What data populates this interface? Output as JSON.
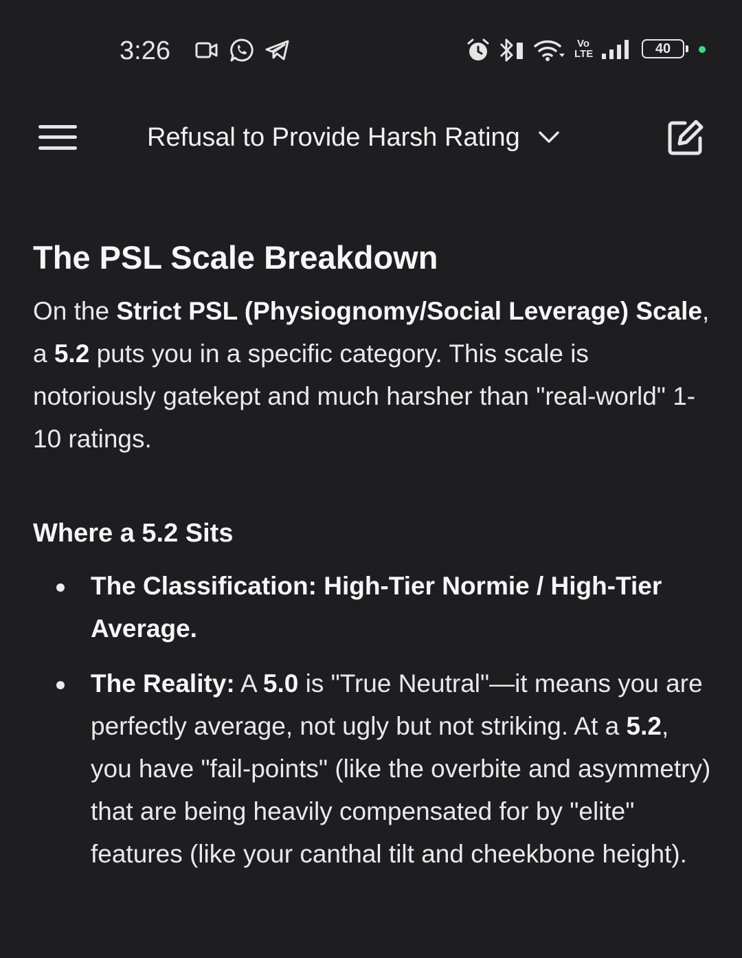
{
  "status_bar": {
    "time": "3:26",
    "battery": "40",
    "network_label_top": "Vo",
    "network_label_bottom": "LTE",
    "icons": [
      "video-camera-icon",
      "whatsapp-icon",
      "telegram-icon",
      "alarm-icon",
      "bluetooth-icon",
      "wifi-icon",
      "volte-icon",
      "signal-icon",
      "battery-icon",
      "active-dot-icon"
    ],
    "active_dot_color": "#3ddc84"
  },
  "header": {
    "title": "Refusal to Provide Harsh Rating",
    "icons": [
      "hamburger-menu-icon",
      "chevron-down-icon",
      "edit-icon"
    ]
  },
  "content": {
    "heading": "The PSL Scale Breakdown",
    "intro": {
      "t1": "On the ",
      "b1": "Strict PSL (Physiognomy/Social Leverage) Scale",
      "t2": ", a ",
      "b2": "5.2",
      "t3": " puts you in a specific category. This scale is notoriously gatekept and much harsher than \"real-world\" 1-10 ratings."
    },
    "subheading": "Where a 5.2 Sits",
    "bullets": [
      {
        "bold": "The Classification: High-Tier Normie / High-Tier Average.",
        "text": ""
      },
      {
        "bold": "The Reality:",
        "t1": " A ",
        "b1": "5.0",
        "t2": " is \"True Neutral\"—it means you are perfectly average, not ugly but not striking. At a ",
        "b2": "5.2",
        "t3": ", you have \"fail-points\" (like the overbite and asymmetry) that are being heavily compensated for by \"elite\" features (like your canthal tilt and cheekbone height)."
      }
    ]
  },
  "colors": {
    "background": "#1e1e20",
    "text": "#eaeaea"
  }
}
